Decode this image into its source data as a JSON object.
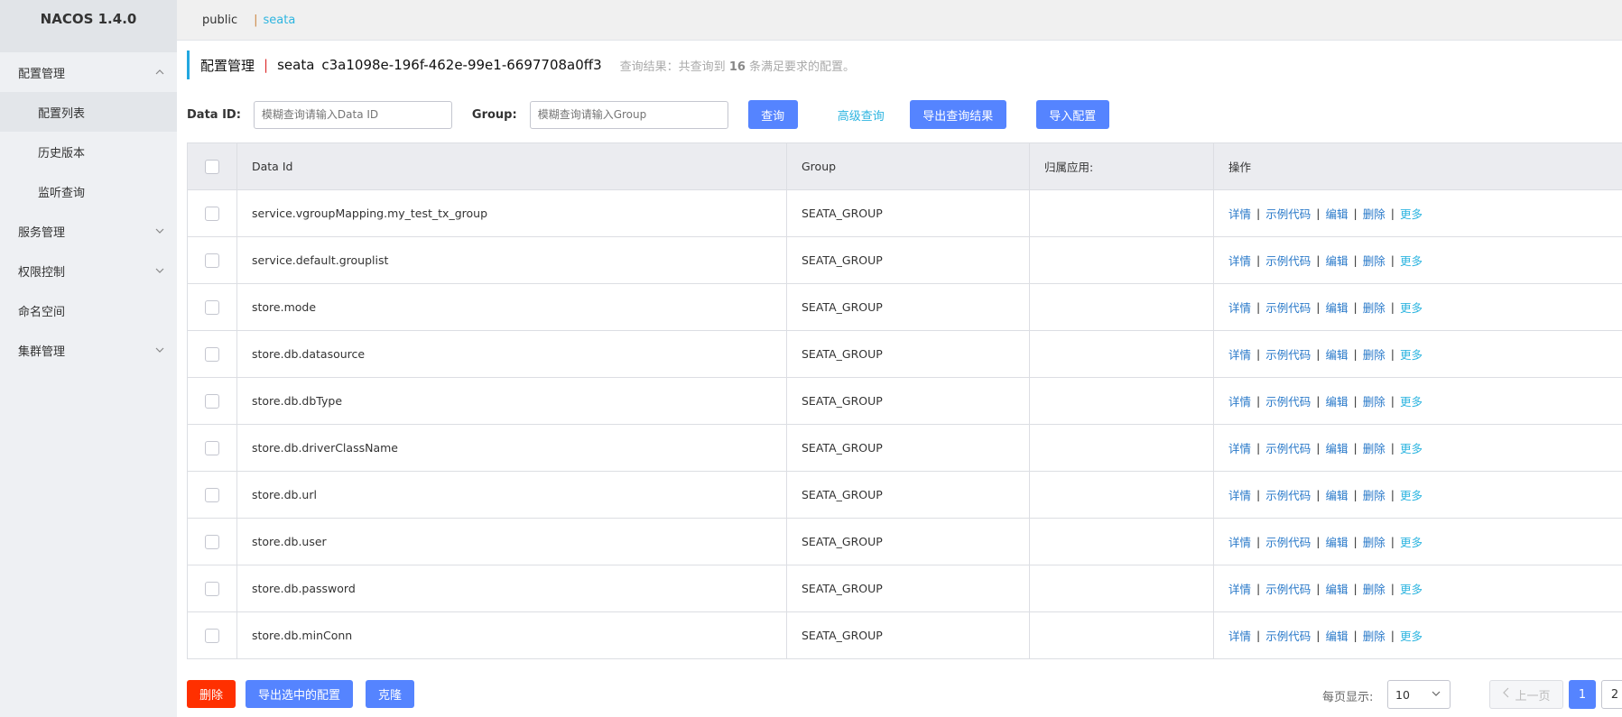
{
  "app": {
    "brand": "NACOS 1.4.0"
  },
  "sidebar": {
    "groups": [
      {
        "label": "配置管理",
        "expanded": true,
        "items": [
          "配置列表",
          "历史版本",
          "监听查询"
        ]
      },
      {
        "label": "服务管理"
      },
      {
        "label": "权限控制"
      },
      {
        "label": "命名空间"
      },
      {
        "label": "集群管理"
      }
    ]
  },
  "namespaces": {
    "public": "public",
    "separator": "|",
    "current": "seata"
  },
  "title": {
    "main": "配置管理",
    "pipe": "|",
    "ns_name": "seata",
    "ns_id": "c3a1098e-196f-462e-99e1-6697708a0ff3",
    "result_prefix": "查询结果：共查询到",
    "result_count": "16",
    "result_suffix": "条满足要求的配置。"
  },
  "search": {
    "data_id_label": "Data ID:",
    "data_id_placeholder": "模糊查询请输入Data ID",
    "group_label": "Group:",
    "group_placeholder": "模糊查询请输入Group",
    "query_button": "查询",
    "advanced_link": "高级查询",
    "export_button": "导出查询结果",
    "import_button": "导入配置"
  },
  "table": {
    "headers": [
      "Data Id",
      "Group",
      "归属应用:",
      "操作"
    ],
    "ops": {
      "detail": "详情",
      "sample": "示例代码",
      "edit": "编辑",
      "delete": "删除",
      "more": "更多",
      "sep": "|"
    },
    "rows": [
      {
        "data_id": "service.vgroupMapping.my_test_tx_group",
        "group": "SEATA_GROUP",
        "app": ""
      },
      {
        "data_id": "service.default.grouplist",
        "group": "SEATA_GROUP",
        "app": ""
      },
      {
        "data_id": "store.mode",
        "group": "SEATA_GROUP",
        "app": ""
      },
      {
        "data_id": "store.db.datasource",
        "group": "SEATA_GROUP",
        "app": ""
      },
      {
        "data_id": "store.db.dbType",
        "group": "SEATA_GROUP",
        "app": ""
      },
      {
        "data_id": "store.db.driverClassName",
        "group": "SEATA_GROUP",
        "app": ""
      },
      {
        "data_id": "store.db.url",
        "group": "SEATA_GROUP",
        "app": ""
      },
      {
        "data_id": "store.db.user",
        "group": "SEATA_GROUP",
        "app": ""
      },
      {
        "data_id": "store.db.password",
        "group": "SEATA_GROUP",
        "app": ""
      },
      {
        "data_id": "store.db.minConn",
        "group": "SEATA_GROUP",
        "app": ""
      }
    ]
  },
  "footer": {
    "delete_button": "删除",
    "export_selected_button": "导出选中的配置",
    "clone_button": "克隆",
    "page_size_label": "每页显示:",
    "page_size": "10",
    "prev": "上一页",
    "pages": [
      "1",
      "2"
    ]
  },
  "colors": {
    "primary": "#5584ff",
    "danger": "#ff3000",
    "link": "#2979c9",
    "accent": "#2eb5e0"
  }
}
